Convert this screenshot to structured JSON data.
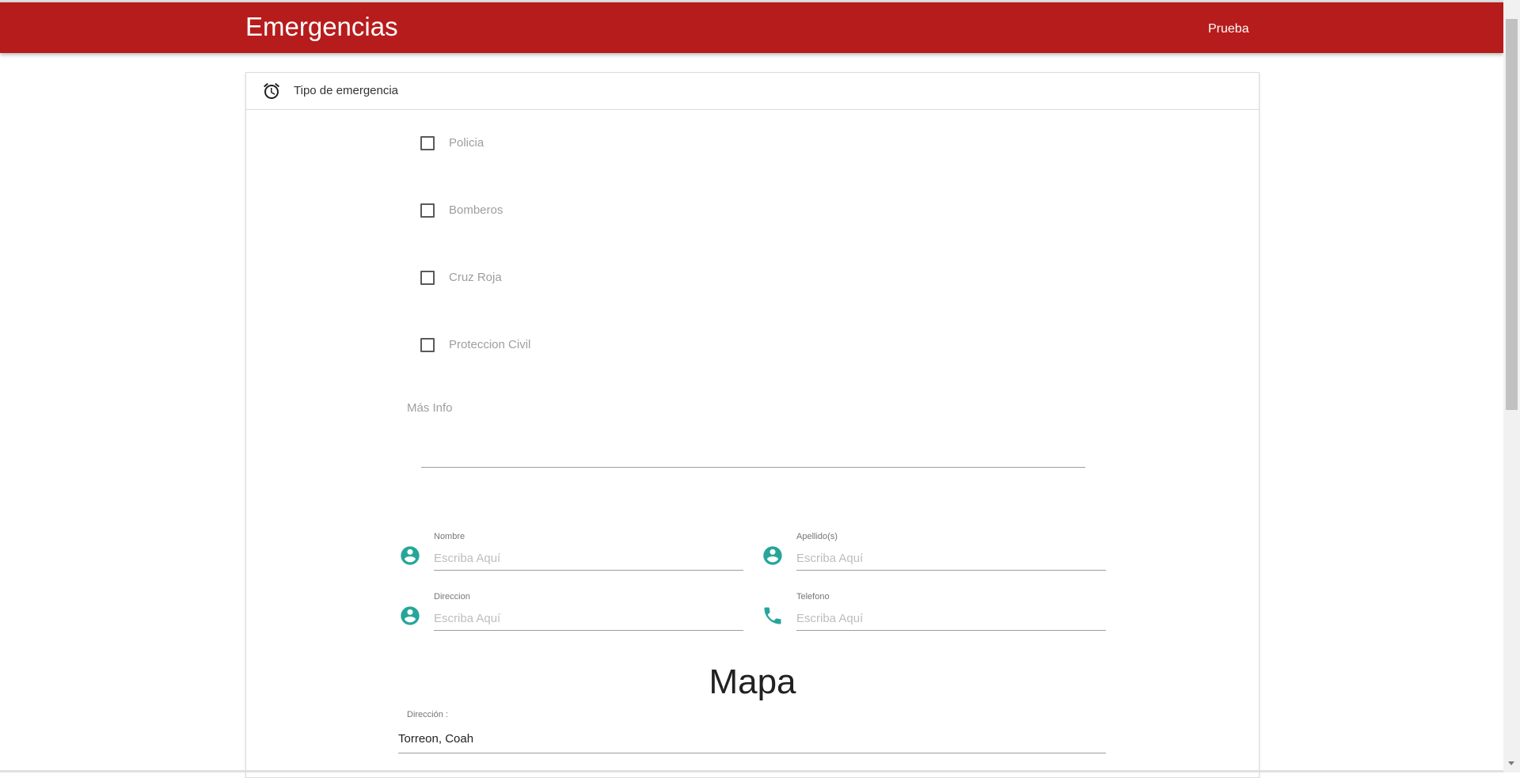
{
  "header": {
    "brand": "Emergencias",
    "user_link": "Prueba",
    "color": "#b71c1c"
  },
  "card": {
    "title": "Tipo de emergencia",
    "title_icon": "alarm-clock-icon",
    "options": [
      {
        "label": "Policia",
        "checked": false
      },
      {
        "label": "Bomberos",
        "checked": false
      },
      {
        "label": "Cruz Roja",
        "checked": false
      },
      {
        "label": "Proteccion Civil",
        "checked": false
      }
    ],
    "more_info_label": "Más Info",
    "fields": {
      "nombre": {
        "label": "Nombre",
        "placeholder": "Escriba Aquí",
        "icon": "account-circle-icon"
      },
      "apellido": {
        "label": "Apellido(s)",
        "placeholder": "Escriba Aquí",
        "icon": "account-circle-icon"
      },
      "direccion": {
        "label": "Direccion",
        "placeholder": "Escriba Aquí",
        "icon": "account-circle-icon"
      },
      "telefono": {
        "label": "Telefono",
        "placeholder": "Escriba Aquí",
        "icon": "phone-icon"
      }
    },
    "icon_color": "#26a69a",
    "map_title": "Mapa",
    "address": {
      "label": "Dirección :",
      "value": "Torreon, Coah"
    }
  }
}
